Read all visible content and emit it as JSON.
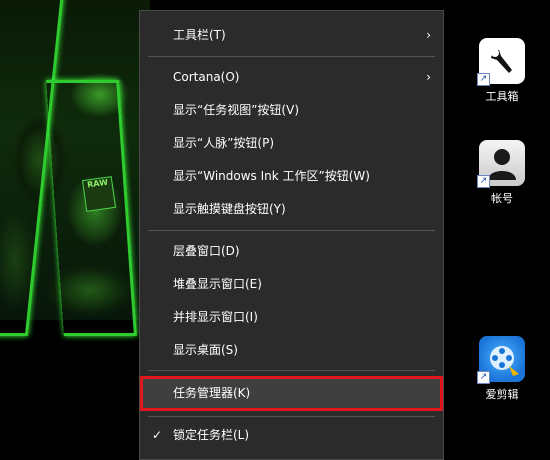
{
  "desktop": {
    "icons": [
      {
        "label": "工具箱",
        "icon": "wrench-icon"
      },
      {
        "label": "帐号",
        "icon": "user-silhouette-icon"
      },
      {
        "label": "爱剪辑",
        "icon": "film-reel-icon"
      }
    ],
    "wallpaper_sign": "RAW"
  },
  "menu": {
    "items": [
      {
        "label": "工具栏(T)",
        "submenu": true
      },
      {
        "label": "Cortana(O)",
        "submenu": true
      },
      {
        "label": "显示“任务视图”按钮(V)"
      },
      {
        "label": "显示“人脉”按钮(P)"
      },
      {
        "label": "显示“Windows Ink 工作区”按钮(W)"
      },
      {
        "label": "显示触摸键盘按钮(Y)"
      },
      {
        "label": "层叠窗口(D)"
      },
      {
        "label": "堆叠显示窗口(E)"
      },
      {
        "label": "并排显示窗口(I)"
      },
      {
        "label": "显示桌面(S)"
      },
      {
        "label": "任务管理器(K)",
        "highlighted": true
      },
      {
        "label": "锁定任务栏(L)",
        "checked": true
      }
    ],
    "submenu_glyph": "›",
    "check_glyph": "✓"
  },
  "colors": {
    "menu_bg": "#2b2b2b",
    "highlight_border": "#e0181e",
    "wallpaper_accent": "#2ecc2e"
  }
}
